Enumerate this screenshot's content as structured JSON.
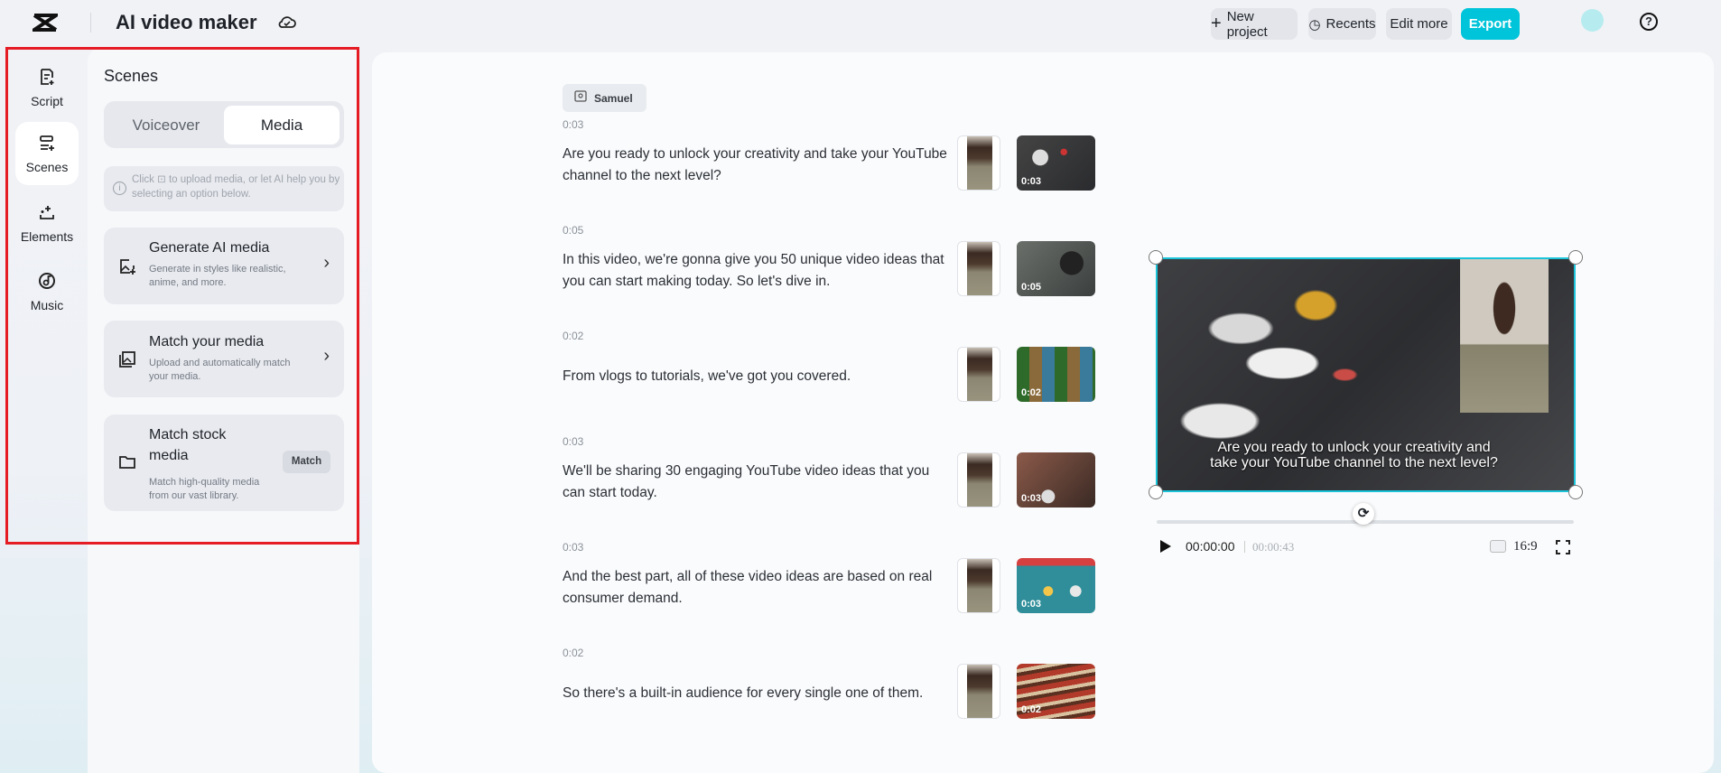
{
  "header": {
    "title": "AI video maker",
    "buttons": {
      "new_project": "New project",
      "recents": "Recents",
      "edit_more": "Edit more",
      "export": "Export"
    },
    "accent": "#00c4d9"
  },
  "nav": [
    {
      "label": "Script",
      "icon": "script-icon"
    },
    {
      "label": "Scenes",
      "icon": "scenes-icon",
      "selected": true
    },
    {
      "label": "Elements",
      "icon": "elements-icon"
    },
    {
      "label": "Music",
      "icon": "music-icon"
    }
  ],
  "panel": {
    "title": "Scenes",
    "tabs": [
      "Voiceover",
      "Media"
    ],
    "active_tab": "Media",
    "info_a": "Click",
    "info_b": "to upload media, or let AI help you by selecting an option below.",
    "cards": [
      {
        "title": "Generate AI media",
        "desc": "Generate in styles like realistic, anime, and more."
      },
      {
        "title": "Match your media",
        "desc": "Upload and automatically match your media."
      },
      {
        "title": "Match stock media",
        "desc": "Match high-quality media from our vast library.",
        "button": "Match"
      }
    ]
  },
  "script": {
    "speaker": "Samuel",
    "scenes": [
      {
        "time": "0:03",
        "text": "Are you ready to unlock your creativity and take your YouTube channel to the next level?",
        "clip": "0:03"
      },
      {
        "time": "0:05",
        "text": "In this video, we're gonna give you 50 unique video ideas that you can start making today. So let's dive in.",
        "clip": "0:05"
      },
      {
        "time": "0:02",
        "text": "From vlogs to tutorials, we've got you covered.",
        "clip": "0:02"
      },
      {
        "time": "0:03",
        "text": "We'll be sharing 30 engaging YouTube video ideas that you can start today.",
        "clip": "0:03"
      },
      {
        "time": "0:03",
        "text": "And the best part, all of these video ideas are based on real consumer demand.",
        "clip": "0:03"
      },
      {
        "time": "0:02",
        "text": "So there's a built-in audience for every single one of them.",
        "clip": "0:02"
      }
    ]
  },
  "preview": {
    "caption": "Are you ready to unlock your creativity and take your YouTube channel to the next level?",
    "current_time": "00:00:00",
    "total_time": "00:00:43",
    "aspect": "16:9",
    "progress": 0
  }
}
